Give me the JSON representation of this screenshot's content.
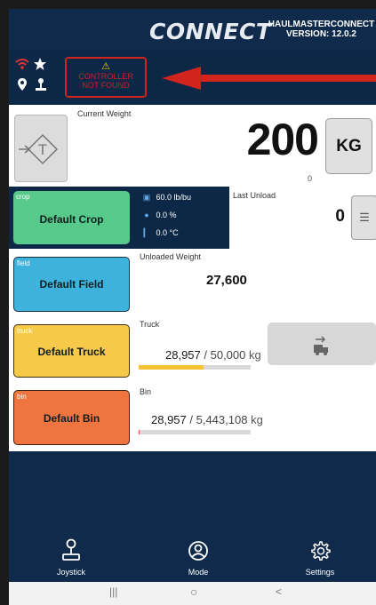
{
  "header": {
    "logo": "CONNECT",
    "app_name": "HAULMASTERCONNECT",
    "version": "VERSION: 12.0.2"
  },
  "status": {
    "icons": [
      "wifi-icon",
      "star-icon",
      "location-pin-icon",
      "joystick-icon"
    ],
    "controller_warning_icon": "⚠",
    "controller_message_line1": "CONTROLLER",
    "controller_message_line2": "NOT FOUND",
    "alert_color": "#d0241d"
  },
  "weight": {
    "label": "Current Weight",
    "value": "200",
    "sub_value": "0",
    "unit": "KG",
    "tare_icon": "T"
  },
  "crop": {
    "tag": "crop",
    "name": "Default Crop",
    "test_weight": "60.0 lb/bu",
    "moisture": "0.0 %",
    "temperature": "0.0 °C",
    "color": "#56c98b"
  },
  "last_unload": {
    "label": "Last Unload",
    "value": "0"
  },
  "field": {
    "tag": "field",
    "name": "Default Field",
    "unloaded_label": "Unloaded Weight",
    "unloaded_value": "27,600",
    "color": "#3db2dd"
  },
  "truck": {
    "tag": "truck",
    "name": "Default Truck",
    "label": "Truck",
    "current": "28,957",
    "max": "/ 50,000",
    "unit": "kg",
    "progress": 0.58,
    "color": "#f7c94b",
    "fill_color": "#f5c231"
  },
  "bin": {
    "tag": "bin",
    "name": "Default Bin",
    "label": "Bin",
    "current": "28,957",
    "max": "/ 5,443,108",
    "unit": "kg",
    "progress": 0.005,
    "color": "#ee7440",
    "fill_color": "#e06030"
  },
  "nav": {
    "items": [
      {
        "label": "Joystick",
        "icon": "joystick-icon"
      },
      {
        "label": "Mode",
        "icon": "mode-icon"
      },
      {
        "label": "Settings",
        "icon": "gear-icon"
      }
    ]
  },
  "system": {
    "recents": "|||",
    "home": "○",
    "back": "<"
  }
}
